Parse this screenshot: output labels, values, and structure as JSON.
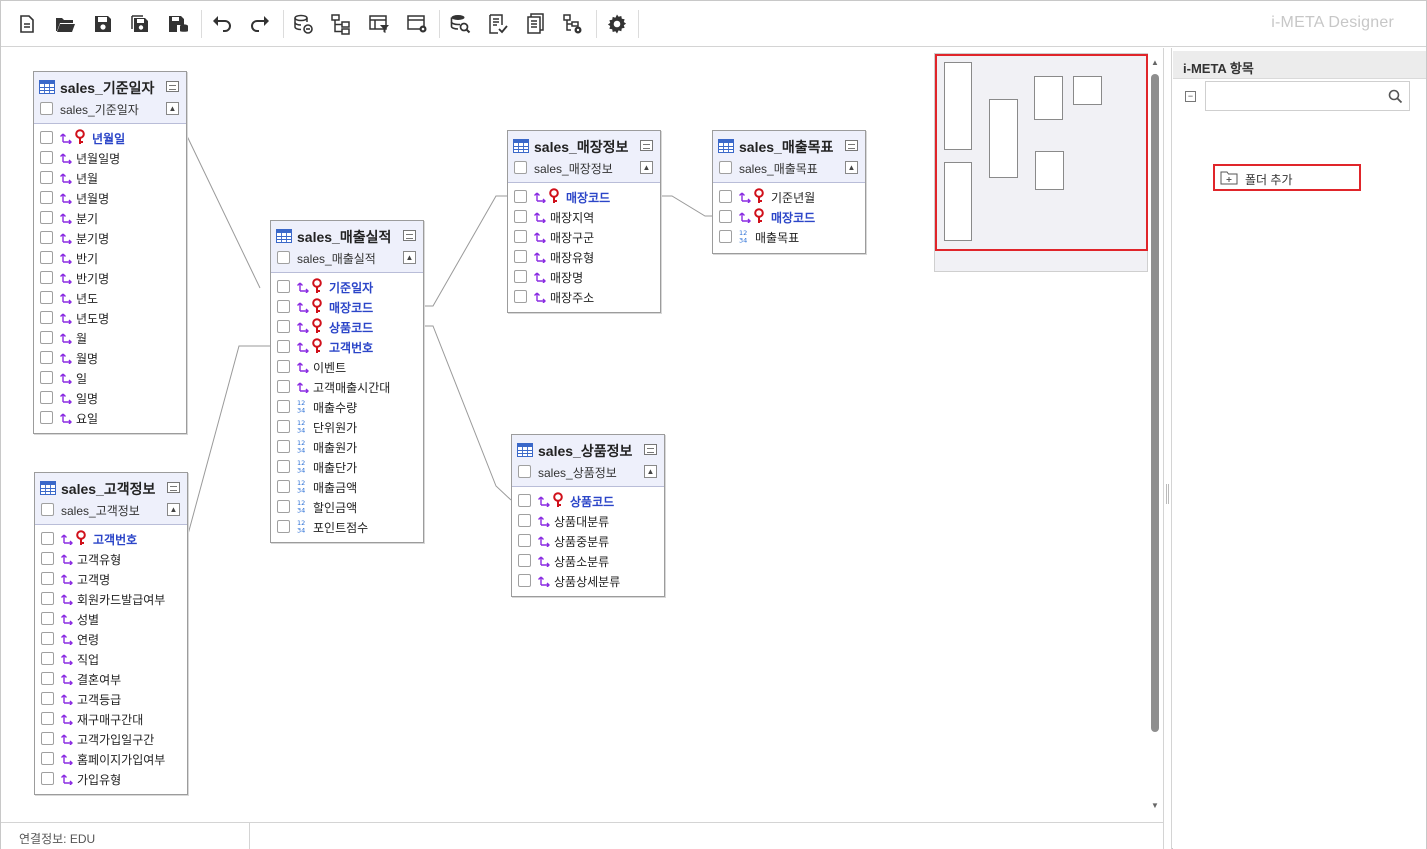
{
  "app": {
    "title": "i-META Designer"
  },
  "toolbar": {
    "buttons": [
      {
        "name": "new-document-icon"
      },
      {
        "name": "open-folder-icon"
      },
      {
        "name": "save-icon"
      },
      {
        "name": "save-as-icon"
      },
      {
        "name": "save-db-icon"
      },
      {
        "name": "undo-icon"
      },
      {
        "name": "redo-icon"
      },
      {
        "name": "connect-db-icon"
      },
      {
        "name": "tree-structure-icon"
      },
      {
        "name": "table-filter-icon"
      },
      {
        "name": "table-settings-icon"
      },
      {
        "name": "db-search-icon"
      },
      {
        "name": "checklist-icon"
      },
      {
        "name": "report-icon"
      },
      {
        "name": "hierarchy-settings-icon"
      },
      {
        "name": "gear-icon"
      }
    ]
  },
  "tables": {
    "date": {
      "title": "sales_기준일자",
      "subtitle": "sales_기준일자",
      "columns": [
        "년월일",
        "년월일명",
        "년월",
        "년월명",
        "분기",
        "분기명",
        "반기",
        "반기명",
        "년도",
        "년도명",
        "월",
        "월명",
        "일",
        "일명",
        "요일"
      ]
    },
    "customer": {
      "title": "sales_고객정보",
      "subtitle": "sales_고객정보",
      "columns": [
        "고객번호",
        "고객유형",
        "고객명",
        "회원카드발급여부",
        "성별",
        "연령",
        "직업",
        "결혼여부",
        "고객등급",
        "재구매구간대",
        "고객가입일구간",
        "홈페이지가입여부",
        "가입유형"
      ]
    },
    "sales": {
      "title": "sales_매출실적",
      "subtitle": "sales_매출실적",
      "columns": [
        "기준일자",
        "매장코드",
        "상품코드",
        "고객번호",
        "이벤트",
        "고객매출시간대",
        "매출수량",
        "단위원가",
        "매출원가",
        "매출단가",
        "매출금액",
        "할인금액",
        "포인트점수"
      ]
    },
    "store": {
      "title": "sales_매장정보",
      "subtitle": "sales_매장정보",
      "columns": [
        "매장코드",
        "매장지역",
        "매장구군",
        "매장유형",
        "매장명",
        "매장주소"
      ]
    },
    "target": {
      "title": "sales_매출목표",
      "subtitle": "sales_매출목표",
      "columns": [
        "기준년월",
        "매장코드",
        "매출목표"
      ]
    },
    "product": {
      "title": "sales_상품정보",
      "subtitle": "sales_상품정보",
      "columns": [
        "상품코드",
        "상품대분류",
        "상품중분류",
        "상품소분류",
        "상품상세분류"
      ]
    }
  },
  "status": {
    "connection": "연결정보: EDU"
  },
  "panel": {
    "title": "i-META 항목",
    "search_placeholder": "",
    "folder_button": "폴더 추가"
  },
  "colors": {
    "accent": "#e0252a",
    "pk_text": "#2b45c8",
    "header_bg": "#eef0fb",
    "dimension_icon": "#8a2be2"
  }
}
